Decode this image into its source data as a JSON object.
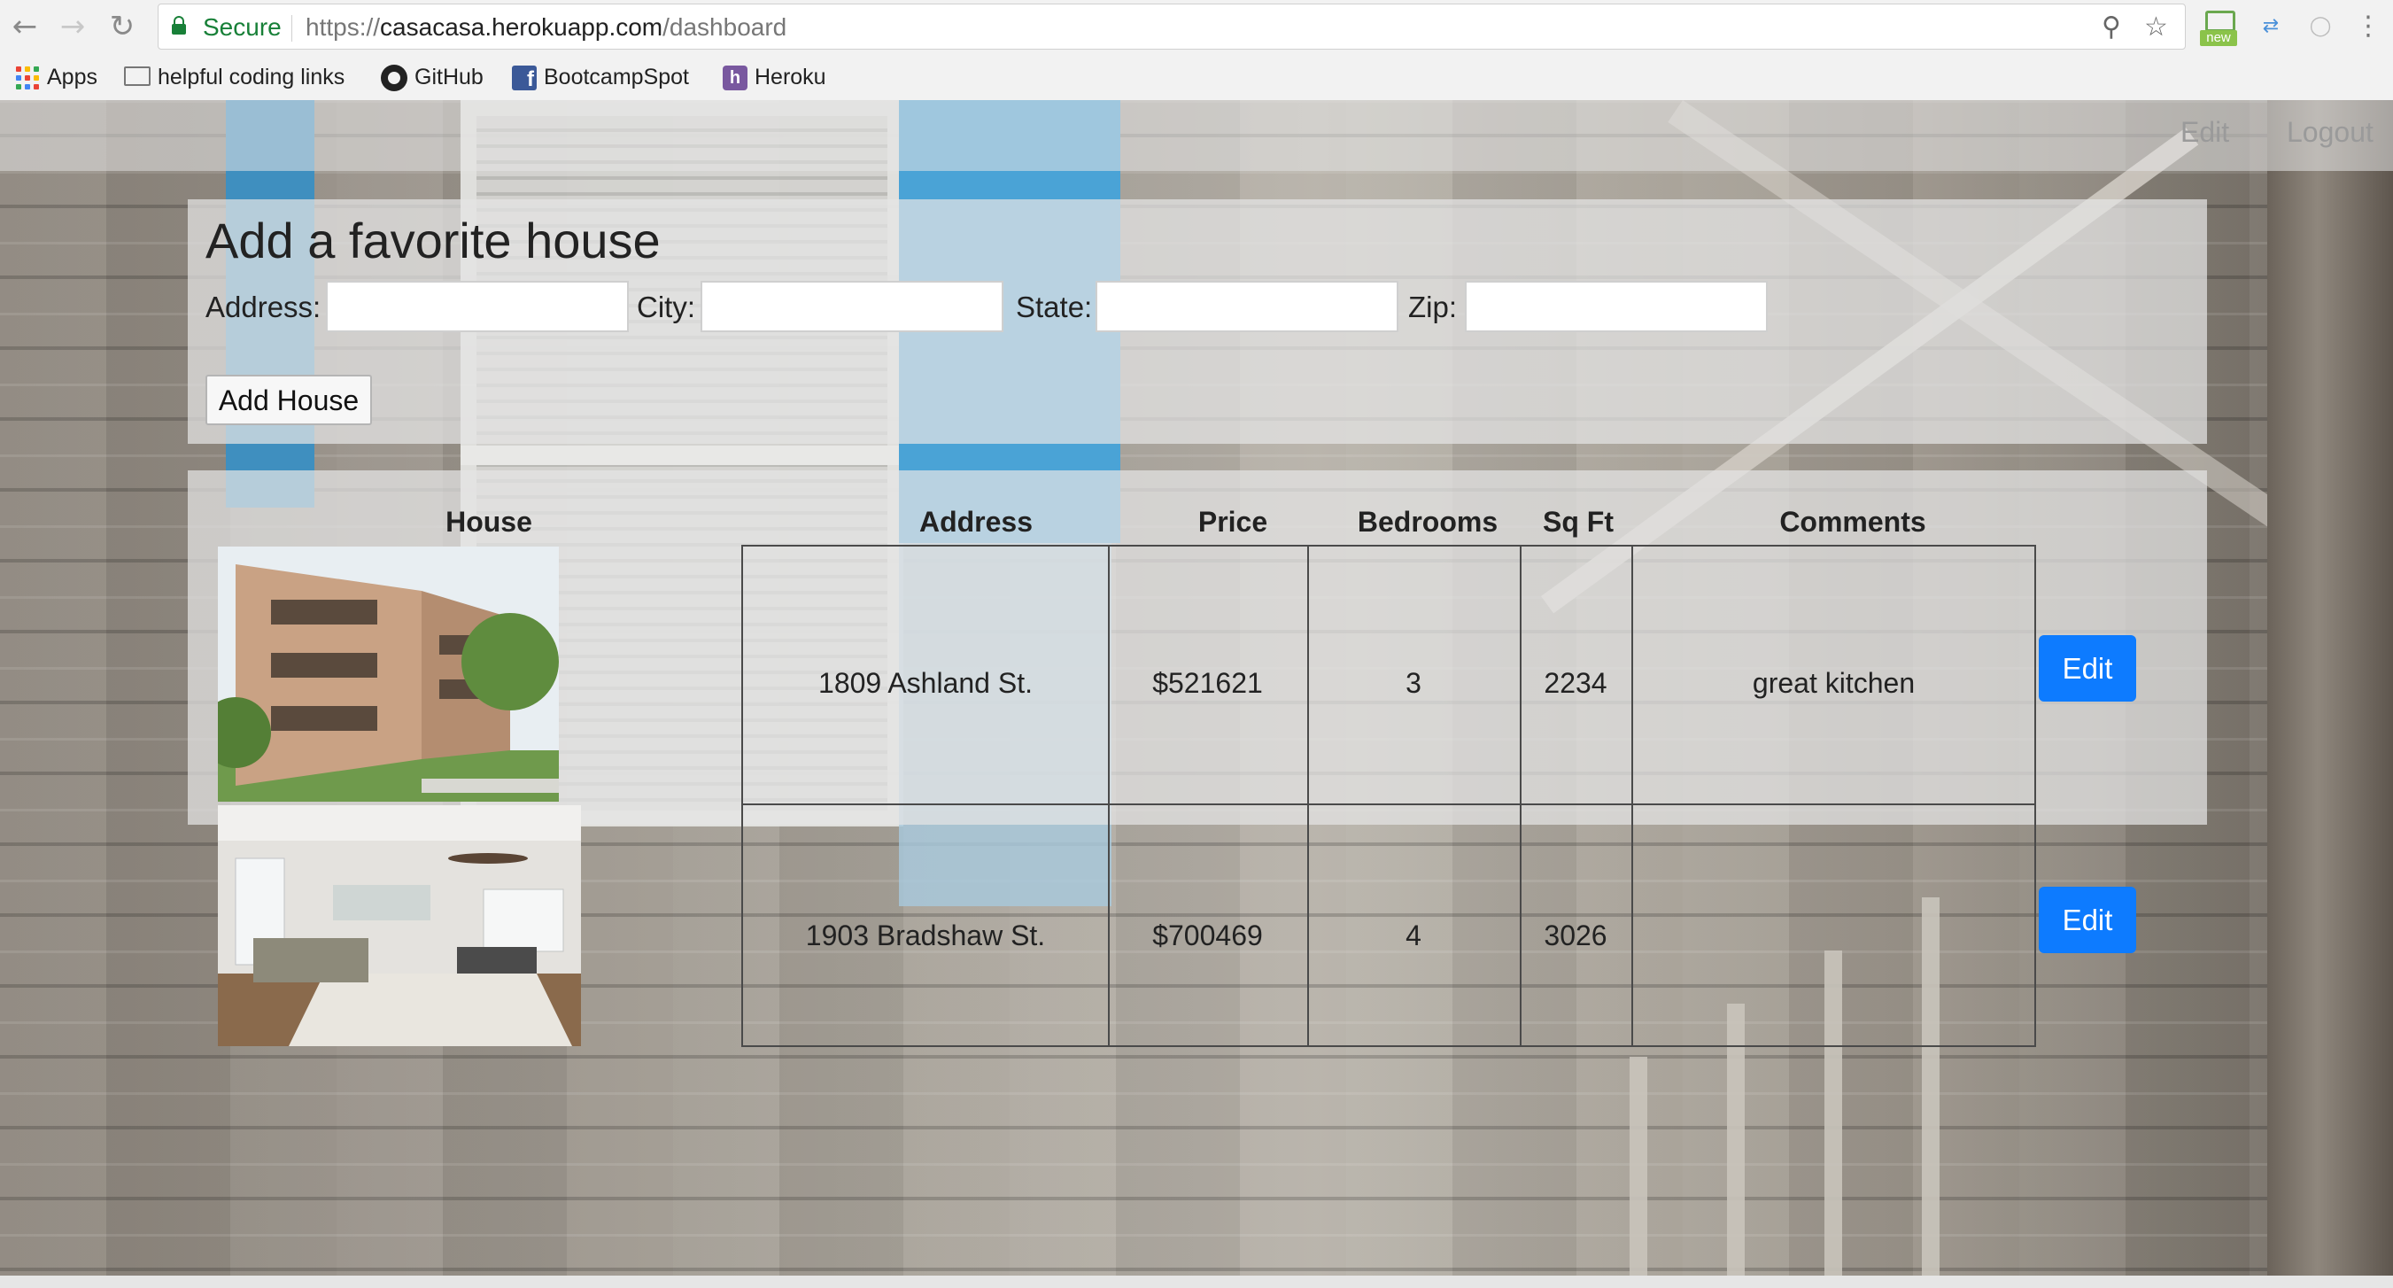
{
  "browser": {
    "secure_label": "Secure",
    "url_scheme": "https://",
    "url_host": "casacasa.herokuapp.com",
    "url_path": "/dashboard",
    "extension_badge": "new",
    "bookmarks": [
      {
        "label": "Apps",
        "icon": "apps-grid-icon"
      },
      {
        "label": "helpful coding links",
        "icon": "folder-icon"
      },
      {
        "label": "GitHub",
        "icon": "github-icon"
      },
      {
        "label": "BootcampSpot",
        "icon": "facebook-icon"
      },
      {
        "label": "Heroku",
        "icon": "heroku-icon"
      }
    ]
  },
  "nav": {
    "edit": "Edit",
    "logout": "Logout"
  },
  "add_form": {
    "title": "Add a favorite house",
    "address_label": "Address:",
    "city_label": "City:",
    "state_label": "State:",
    "zip_label": "Zip:",
    "address_value": "",
    "city_value": "",
    "state_value": "",
    "zip_value": "",
    "submit_label": "Add House"
  },
  "table": {
    "headers": [
      "House",
      "Address",
      "Price",
      "Bedrooms",
      "Sq Ft",
      "Comments"
    ],
    "rows": [
      {
        "address": "1809 Ashland St.",
        "price": "$521621",
        "bedrooms": "3",
        "sqft": "2234",
        "comments": "great kitchen",
        "edit_label": "Edit",
        "photo": "townhouse-exterior-photo"
      },
      {
        "address": "1903 Bradshaw St.",
        "price": "$700469",
        "bedrooms": "4",
        "sqft": "3026",
        "comments": "",
        "edit_label": "Edit",
        "photo": "living-room-interior-photo"
      }
    ]
  },
  "colors": {
    "secure_green": "#188038",
    "edit_button_blue": "#0d7bff"
  }
}
